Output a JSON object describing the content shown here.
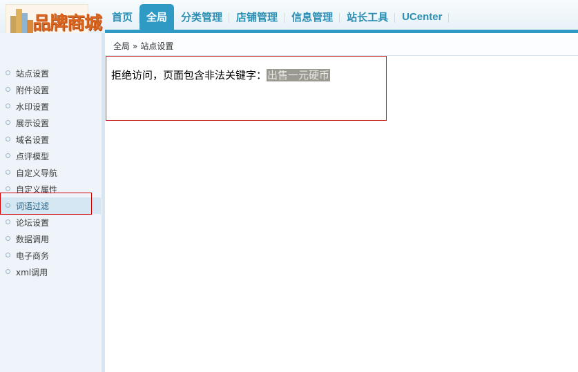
{
  "logo": {
    "text": "品牌商城"
  },
  "nav": {
    "items": [
      {
        "label": "首页"
      },
      {
        "label": "全局"
      },
      {
        "label": "分类管理"
      },
      {
        "label": "店铺管理"
      },
      {
        "label": "信息管理"
      },
      {
        "label": "站长工具"
      },
      {
        "label": "UCenter"
      }
    ],
    "active_index": 1
  },
  "breadcrumb": {
    "root": "全局",
    "separator": "»",
    "current": "站点设置"
  },
  "sidebar": {
    "items": [
      {
        "label": "站点设置"
      },
      {
        "label": "附件设置"
      },
      {
        "label": "水印设置"
      },
      {
        "label": "展示设置"
      },
      {
        "label": "域名设置"
      },
      {
        "label": "点评模型"
      },
      {
        "label": "自定义导航"
      },
      {
        "label": "自定义属性"
      },
      {
        "label": "词语过滤"
      },
      {
        "label": "论坛设置"
      },
      {
        "label": "数据调用"
      },
      {
        "label": "电子商务"
      },
      {
        "label": "xml调用"
      }
    ],
    "active_index": 8
  },
  "message": {
    "text": "拒绝访问，页面包含非法关键字：",
    "keyword": "出售一元硬币"
  },
  "colors": {
    "accent": "#2f9bc5",
    "highlight_border": "#d00000"
  }
}
